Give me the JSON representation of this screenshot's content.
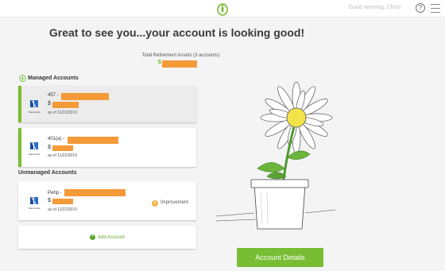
{
  "header": {
    "greeting": "Good morning, Chris!",
    "help_label": "?"
  },
  "headline": "Great to see you...your account is looking good!",
  "total": {
    "label": "Total Retirement Assets (3 accounts):",
    "dollar_sign": "$"
  },
  "sections": {
    "managed_title": "Managed Accounts",
    "unmanaged_title": "Unmanaged Accounts"
  },
  "accounts": [
    {
      "type": "457 -",
      "dollar": "$",
      "date": "as of 11/22/2019",
      "provider": "Nationwide",
      "selected": true
    },
    {
      "type": "401(a) -",
      "dollar": "$",
      "date": "as of 11/22/2019",
      "provider": "Nationwide",
      "selected": false
    },
    {
      "type": "Pehp -",
      "dollar": "$",
      "date": "as of 11/22/2019",
      "provider": "Nationwide",
      "badge_count": "1",
      "badge_label": "Improvement"
    }
  ],
  "add_account": {
    "label": "Add Account",
    "icon": "plus-icon"
  },
  "cta": {
    "label": "Account Details"
  },
  "colors": {
    "brand_green": "#78bd34",
    "redaction": "#f59a38",
    "improvement_badge": "#f3b343"
  }
}
